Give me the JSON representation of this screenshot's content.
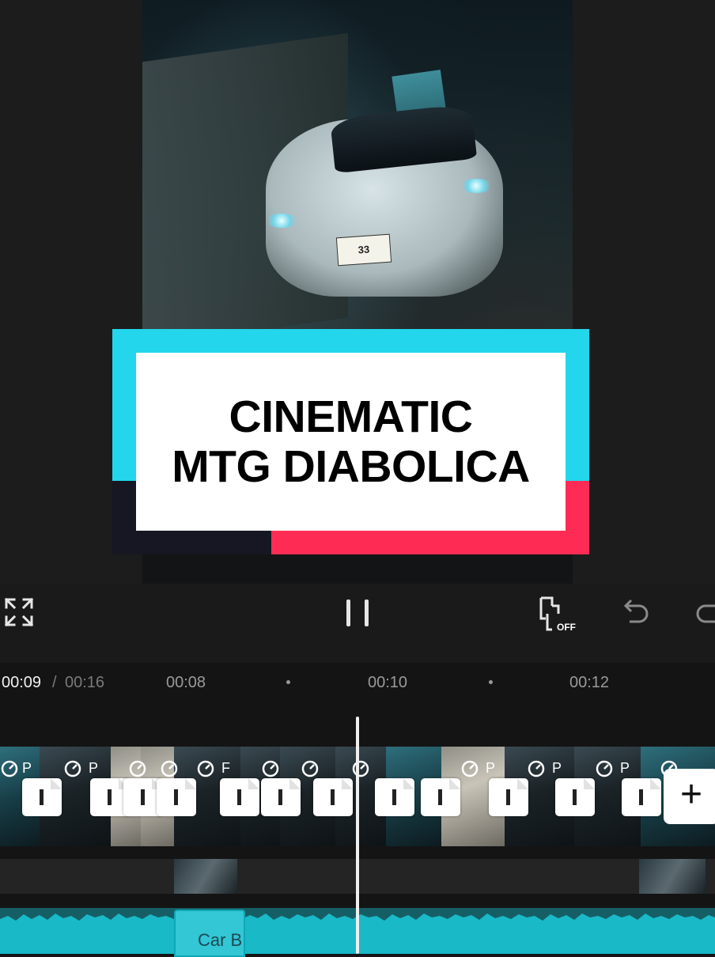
{
  "preview": {
    "title_card": {
      "line1": "CINEMATIC",
      "line2": "MTG DIABOLICA",
      "colors": {
        "cyan": "#23d6ec",
        "red": "#fe2c55",
        "dark": "#161722",
        "card": "#ffffff"
      }
    },
    "plate_text": "33"
  },
  "toolbar": {
    "fullscreen_icon": "fullscreen-icon",
    "play_icon": "pause-icon",
    "keyframe_icon": "keyframe-off-icon",
    "keyframe_state": "OFF",
    "undo_icon": "undo-icon",
    "redo_icon": "redo-icon"
  },
  "timeline": {
    "current_time": "00:09",
    "separator": "/",
    "total_time": "00:16",
    "ruler": [
      "00:08",
      "00:10",
      "00:12"
    ],
    "clip_marker_letter": "P",
    "clip_marker_letter_alt": "F",
    "add_clip_label": "+",
    "audio_clip_label": "Car B"
  }
}
